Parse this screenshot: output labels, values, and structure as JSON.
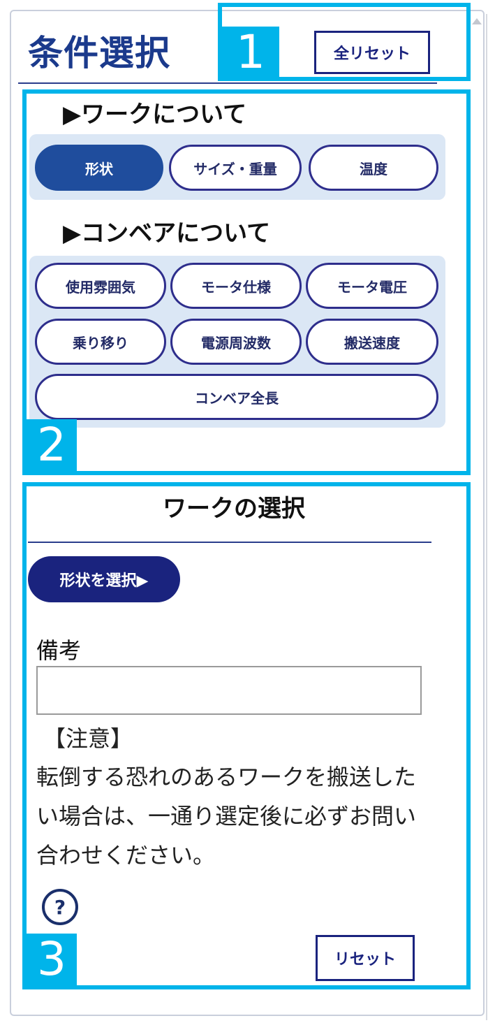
{
  "header": {
    "title": "条件選択",
    "reset_all_label": "全リセット"
  },
  "annotations": [
    "1",
    "2",
    "3"
  ],
  "work_section": {
    "heading": "▶ワークについて",
    "tabs": [
      {
        "label": "形状",
        "active": true
      },
      {
        "label": "サイズ・重量",
        "active": false
      },
      {
        "label": "温度",
        "active": false
      }
    ]
  },
  "conveyor_section": {
    "heading": "▶コンベアについて",
    "tabs": [
      {
        "label": "使用雰囲気"
      },
      {
        "label": "モータ仕様"
      },
      {
        "label": "モータ電圧"
      },
      {
        "label": "乗り移り"
      },
      {
        "label": "電源周波数"
      },
      {
        "label": "搬送速度"
      },
      {
        "label": "コンベア全長"
      }
    ]
  },
  "work_selection": {
    "title": "ワークの選択",
    "select_shape_label": "形状を選択▶",
    "notes_label": "備考",
    "notes_value": "",
    "caution_title": "【注意】",
    "caution_text": "転倒する恐れのあるワークを搬送したい場合は、一通り選定後に必ずお問い合わせください。",
    "help_symbol": "?",
    "reset_label": "リセット"
  },
  "colors": {
    "accent_blue": "#1f4d9d",
    "navy": "#1a237e",
    "highlight": "#00b4ea",
    "group_bg": "#dbe7f5"
  }
}
